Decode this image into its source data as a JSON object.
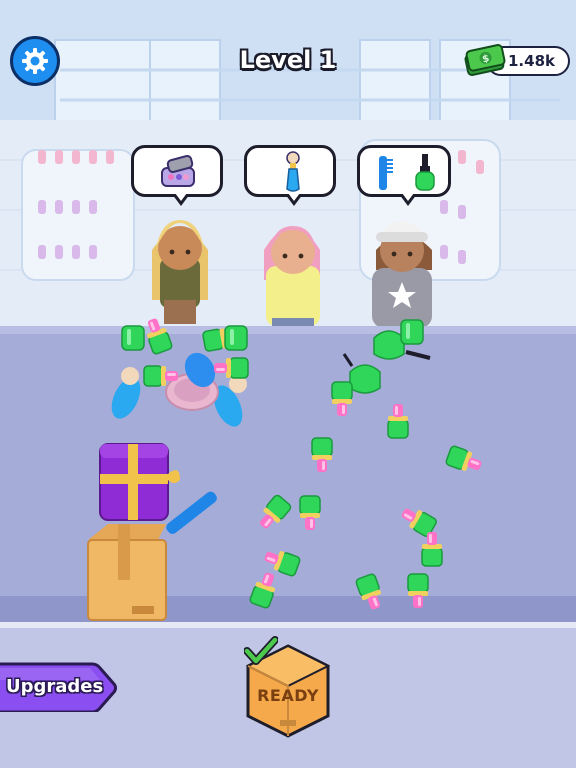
{
  "hud": {
    "level_title": "Level 1",
    "money": "1.48k",
    "settings_icon": "gear-icon",
    "money_icon": "cash-stack-icon"
  },
  "orders": [
    {
      "customer": "blonde-girl",
      "items": [
        "compact-palette-icon"
      ]
    },
    {
      "customer": "pink-hair-girl",
      "items": [
        "makeup-brush-icon"
      ]
    },
    {
      "customer": "beanie-girl",
      "items": [
        "comb-icon",
        "nail-polish-icon"
      ]
    }
  ],
  "buttons": {
    "upgrades": "Upgrades",
    "ready": "READY"
  },
  "colors": {
    "accent_blue": "#1e8ff0",
    "counter": "#a5acd8",
    "upgrades_purple": "#8b4ef0",
    "ready_orange": "#f6a94a",
    "check_green": "#4cc94c",
    "lipstick_green": "#2fd65a",
    "lipstick_pink": "#ff6fc6"
  }
}
